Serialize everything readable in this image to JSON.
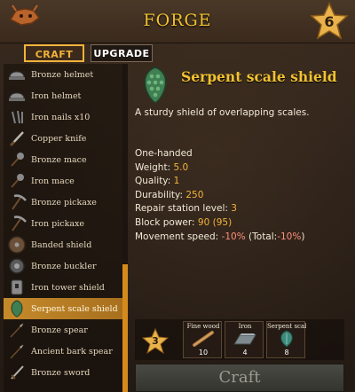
{
  "header": {
    "title": "FORGE",
    "station_level": "6",
    "logo_icon": "forge-logo-icon",
    "station_icon": "star-badge-icon"
  },
  "tabs": {
    "craft_label": "CRAFT",
    "upgrade_label": "UPGRADE"
  },
  "recipes": [
    {
      "label": "Bronze helmet",
      "icon": "helmet-icon"
    },
    {
      "label": "Iron helmet",
      "icon": "helmet-icon"
    },
    {
      "label": "Iron nails x10",
      "icon": "nails-icon"
    },
    {
      "label": "Copper knife",
      "icon": "knife-icon"
    },
    {
      "label": "Bronze mace",
      "icon": "mace-icon"
    },
    {
      "label": "Iron mace",
      "icon": "mace-icon"
    },
    {
      "label": "Bronze pickaxe",
      "icon": "pickaxe-icon"
    },
    {
      "label": "Iron pickaxe",
      "icon": "pickaxe-icon"
    },
    {
      "label": "Banded shield",
      "icon": "round-shield-icon"
    },
    {
      "label": "Bronze buckler",
      "icon": "buckler-icon"
    },
    {
      "label": "Iron tower shield",
      "icon": "tower-shield-icon"
    },
    {
      "label": "Serpent scale shield",
      "icon": "scale-shield-icon",
      "selected": true
    },
    {
      "label": "Bronze spear",
      "icon": "spear-icon"
    },
    {
      "label": "Ancient bark spear",
      "icon": "spear-icon"
    },
    {
      "label": "Bronze sword",
      "icon": "sword-icon"
    }
  ],
  "selected": {
    "title": "Serpent scale shield",
    "description": "A sturdy shield of overlapping scales.",
    "stats": {
      "handedness": "One-handed",
      "weight_label": "Weight: ",
      "weight": "5.0",
      "quality_label": "Quality: ",
      "quality": "1",
      "durability_label": "Durability: ",
      "durability": "250",
      "repair_label": "Repair station level: ",
      "repair": "3",
      "block_label": "Block power: ",
      "block": "90",
      "block_next": "(95)",
      "movement_label": "Movement speed: ",
      "movement": "-10%",
      "movement_total_prefix": " (Total:",
      "movement_total": "-10%",
      "movement_total_suffix": ")"
    }
  },
  "requirements": {
    "level": "3",
    "items": [
      {
        "name": "Fine wood",
        "amount": "10",
        "icon": "fine-wood-icon"
      },
      {
        "name": "Iron",
        "amount": "4",
        "icon": "iron-bar-icon"
      },
      {
        "name": "Serpent scale",
        "amount": "8",
        "icon": "serpent-scale-icon"
      }
    ]
  },
  "craft_label": "Craft",
  "colors": {
    "accent": "#f2c230",
    "selected_row": "#c58a2a",
    "negative": "#ff8f7d"
  }
}
